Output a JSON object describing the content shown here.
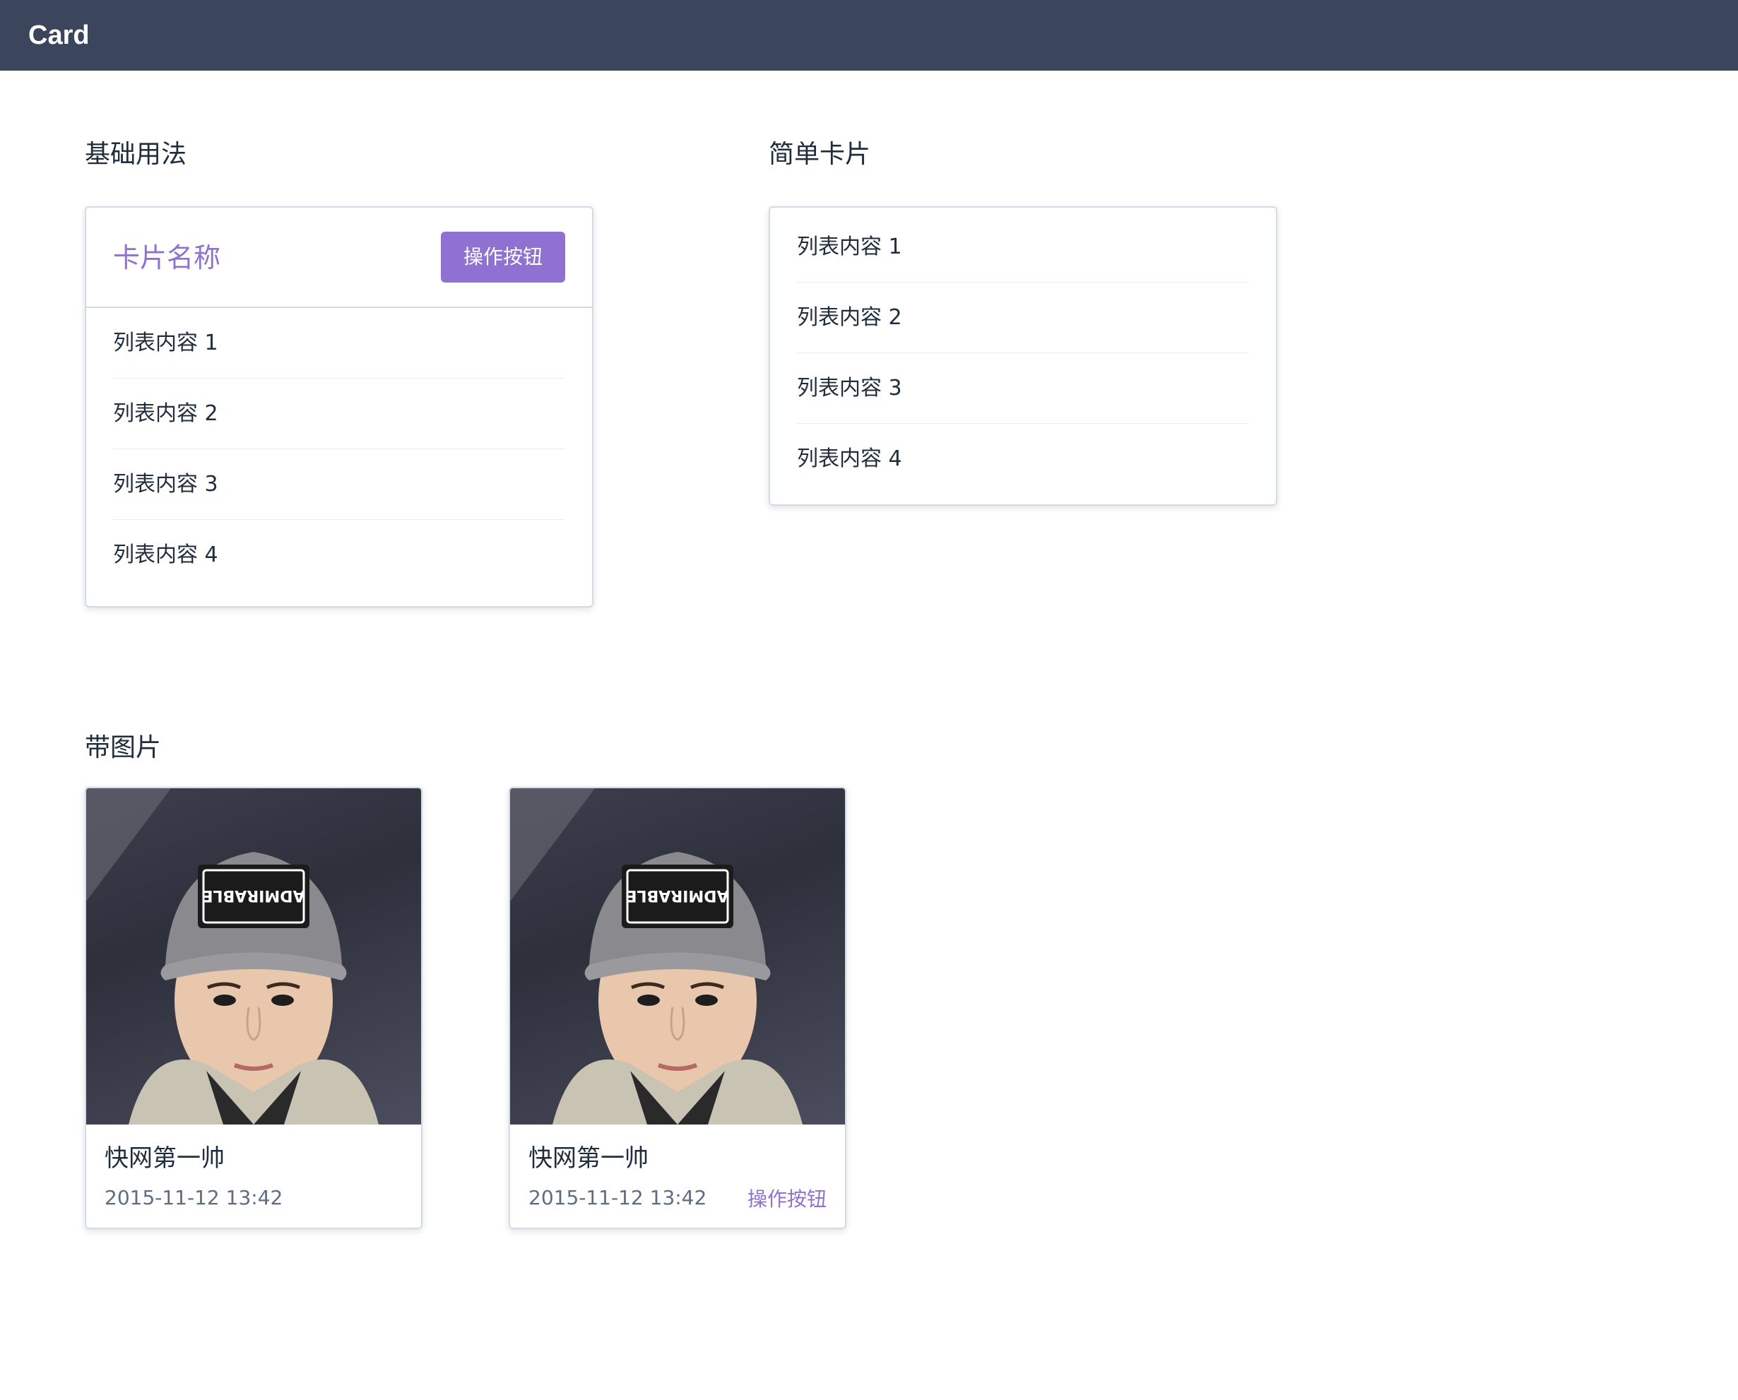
{
  "header": {
    "title": "Card"
  },
  "basic": {
    "section_title": "基础用法",
    "card_name": "卡片名称",
    "action_label": "操作按钮",
    "items": [
      "列表内容 1",
      "列表内容 2",
      "列表内容 3",
      "列表内容 4"
    ]
  },
  "simple": {
    "section_title": "简单卡片",
    "items": [
      "列表内容 1",
      "列表内容 2",
      "列表内容 3",
      "列表内容 4"
    ]
  },
  "image": {
    "section_title": "带图片",
    "cards": [
      {
        "title": "快网第一帅",
        "time": "2015-11-12 13:42",
        "action_label": ""
      },
      {
        "title": "快网第一帅",
        "time": "2015-11-12 13:42",
        "action_label": "操作按钮"
      }
    ],
    "cap_text": "ADMIRABLE"
  },
  "colors": {
    "topbar": "#3b465d",
    "accent": "#8e71d0",
    "border": "#d1dbe5",
    "muted_text": "#5e6d82"
  }
}
